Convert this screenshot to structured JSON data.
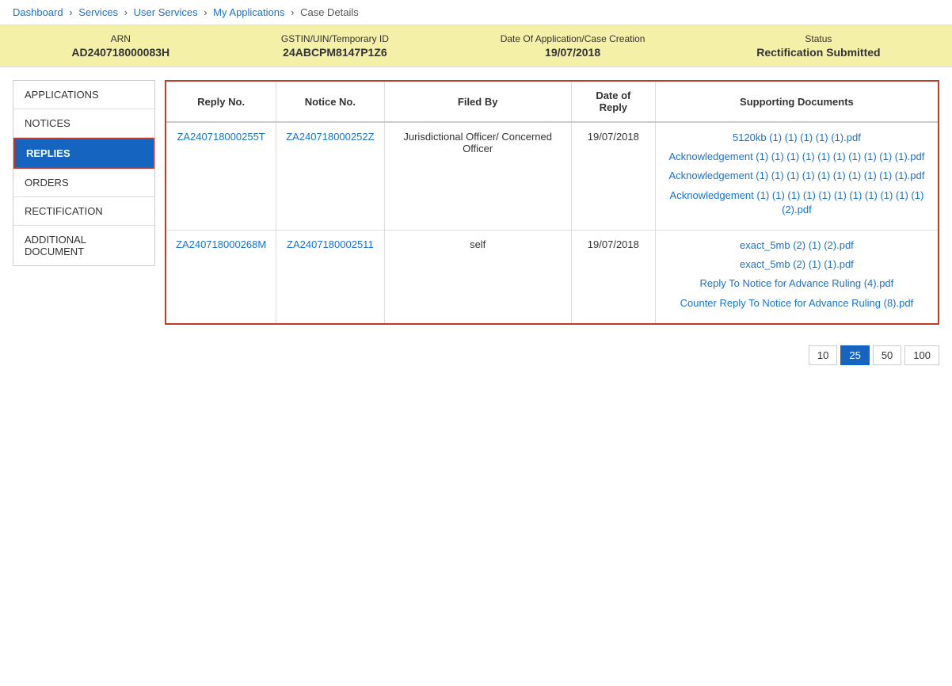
{
  "breadcrumb": {
    "items": [
      {
        "label": "Dashboard",
        "link": true
      },
      {
        "label": "Services",
        "link": true
      },
      {
        "label": "User Services",
        "link": true
      },
      {
        "label": "My Applications",
        "link": true
      },
      {
        "label": "Case Details",
        "link": false
      }
    ],
    "separator": "›"
  },
  "header": {
    "fields": [
      {
        "label": "ARN",
        "value": "AD240718000083H"
      },
      {
        "label": "GSTIN/UIN/Temporary ID",
        "value": "24ABCPM8147P1Z6"
      },
      {
        "label": "Date Of Application/Case Creation",
        "value": "19/07/2018"
      },
      {
        "label": "Status",
        "value": "Rectification Submitted"
      }
    ]
  },
  "sidebar": {
    "items": [
      {
        "label": "APPLICATIONS",
        "active": false
      },
      {
        "label": "NOTICES",
        "active": false
      },
      {
        "label": "REPLIES",
        "active": true
      },
      {
        "label": "ORDERS",
        "active": false
      },
      {
        "label": "RECTIFICATION",
        "active": false
      },
      {
        "label": "ADDITIONAL DOCUMENT",
        "active": false
      }
    ]
  },
  "table": {
    "headers": [
      "Reply No.",
      "Notice No.",
      "Filed By",
      "Date of Reply",
      "Supporting Documents"
    ],
    "rows": [
      {
        "reply_no": "ZA240718000255T",
        "notice_no": "ZA240718000252Z",
        "filed_by": "Jurisdictional Officer/ Concerned Officer",
        "date_of_reply": "19/07/2018",
        "documents": [
          "5120kb (1) (1) (1) (1) (1).pdf",
          "Acknowledgement (1) (1) (1) (1) (1) (1) (1) (1) (1) (1).pdf",
          "Acknowledgement (1) (1) (1) (1) (1) (1) (1) (1) (1) (1).pdf",
          "Acknowledgement (1) (1) (1) (1) (1) (1) (1) (1) (1) (1) (1) (2).pdf"
        ]
      },
      {
        "reply_no": "ZA240718000268M",
        "notice_no": "ZA2407180002511",
        "filed_by": "self",
        "date_of_reply": "19/07/2018",
        "documents": [
          "exact_5mb (2) (1) (2).pdf",
          "exact_5mb (2) (1) (1).pdf",
          "Reply To Notice for Advance Ruling (4).pdf",
          "Counter Reply To Notice for Advance Ruling (8).pdf"
        ]
      }
    ]
  },
  "pagination": {
    "options": [
      "10",
      "25",
      "50",
      "100"
    ],
    "active": "25"
  }
}
